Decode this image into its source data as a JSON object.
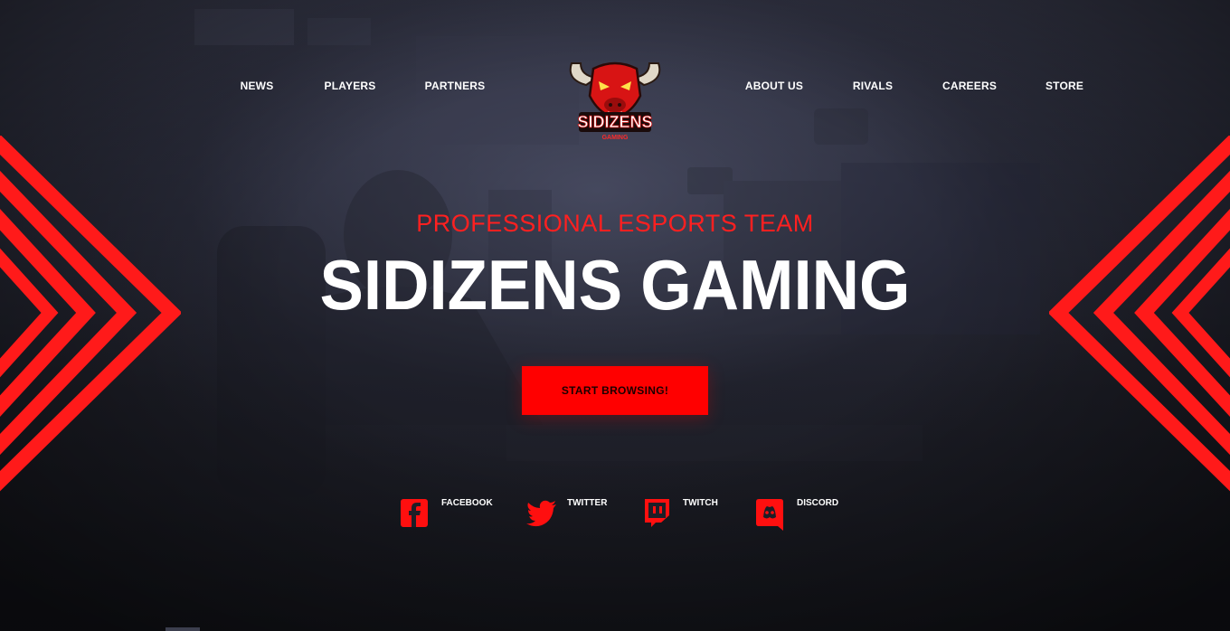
{
  "nav": {
    "left": [
      {
        "label": "NEWS"
      },
      {
        "label": "PLAYERS"
      },
      {
        "label": "PARTNERS"
      }
    ],
    "right": [
      {
        "label": "ABOUT US"
      },
      {
        "label": "RIVALS"
      },
      {
        "label": "CAREERS"
      },
      {
        "label": "STORE"
      }
    ]
  },
  "logo": {
    "icon": "bull-mascot-logo",
    "text": "SIDIZENS",
    "subtext": "GAMING"
  },
  "hero": {
    "tagline": "PROFESSIONAL ESPORTS TEAM",
    "title": "SIDIZENS GAMING",
    "cta_label": "START BROWSING!"
  },
  "social": [
    {
      "label": "FACEBOOK",
      "icon": "facebook-icon"
    },
    {
      "label": "TWITTER",
      "icon": "twitter-icon"
    },
    {
      "label": "TWITCH",
      "icon": "twitch-icon"
    },
    {
      "label": "DISCORD",
      "icon": "discord-icon"
    }
  ],
  "colors": {
    "accent": "#ff0000",
    "background": "#1d1e27",
    "text": "#ffffff"
  }
}
